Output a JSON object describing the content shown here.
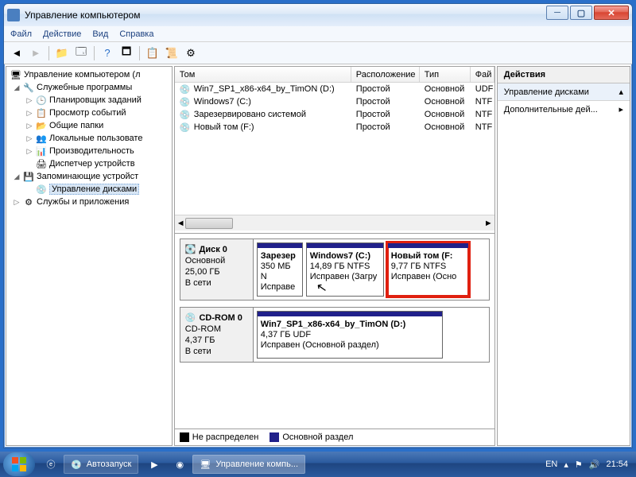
{
  "window": {
    "title": "Управление компьютером"
  },
  "menu": {
    "file": "Файл",
    "action": "Действие",
    "view": "Вид",
    "help": "Справка"
  },
  "tree": {
    "root": "Управление компьютером (л",
    "system_tools": "Служебные программы",
    "task_scheduler": "Планировщик заданий",
    "event_viewer": "Просмотр событий",
    "shared_folders": "Общие папки",
    "local_users": "Локальные пользовате",
    "performance": "Производительность",
    "device_manager": "Диспетчер устройств",
    "storage": "Запоминающие устройст",
    "disk_mgmt": "Управление дисками",
    "services_apps": "Службы и приложения"
  },
  "vol_cols": {
    "volume": "Том",
    "layout": "Расположение",
    "type": "Тип",
    "fs": "Фай"
  },
  "volumes": [
    {
      "name": "Win7_SP1_x86-x64_by_TimON (D:)",
      "layout": "Простой",
      "type": "Основной",
      "fs": "UDF"
    },
    {
      "name": "Windows7 (C:)",
      "layout": "Простой",
      "type": "Основной",
      "fs": "NTF"
    },
    {
      "name": "Зарезервировано системой",
      "layout": "Простой",
      "type": "Основной",
      "fs": "NTF"
    },
    {
      "name": "Новый том (F:)",
      "layout": "Простой",
      "type": "Основной",
      "fs": "NTF"
    }
  ],
  "disk0": {
    "label": "Диск 0",
    "type": "Основной",
    "size": "25,00 ГБ",
    "status": "В сети",
    "parts": [
      {
        "name": "Зарезер",
        "detail": "350 МБ N",
        "status": "Исправе"
      },
      {
        "name": "Windows7  (C:)",
        "detail": "14,89 ГБ NTFS",
        "status": "Исправен (Загру"
      },
      {
        "name": "Новый том  (F:",
        "detail": "9,77 ГБ NTFS",
        "status": "Исправен (Осно"
      }
    ]
  },
  "cdrom": {
    "label": "CD-ROM 0",
    "type": "CD-ROM",
    "size": "4,37 ГБ",
    "status": "В сети",
    "part": {
      "name": "Win7_SP1_x86-x64_by_TimON  (D:)",
      "detail": "4,37 ГБ UDF",
      "status": "Исправен (Основной раздел)"
    }
  },
  "legend": {
    "unalloc": "Не распределен",
    "primary": "Основной раздел"
  },
  "actions": {
    "header": "Действия",
    "disk_mgmt": "Управление дисками",
    "more": "Дополнительные дей..."
  },
  "taskbar": {
    "autoplay": "Автозапуск",
    "compmgmt": "Управление компь...",
    "lang": "EN",
    "time": "21:54"
  }
}
